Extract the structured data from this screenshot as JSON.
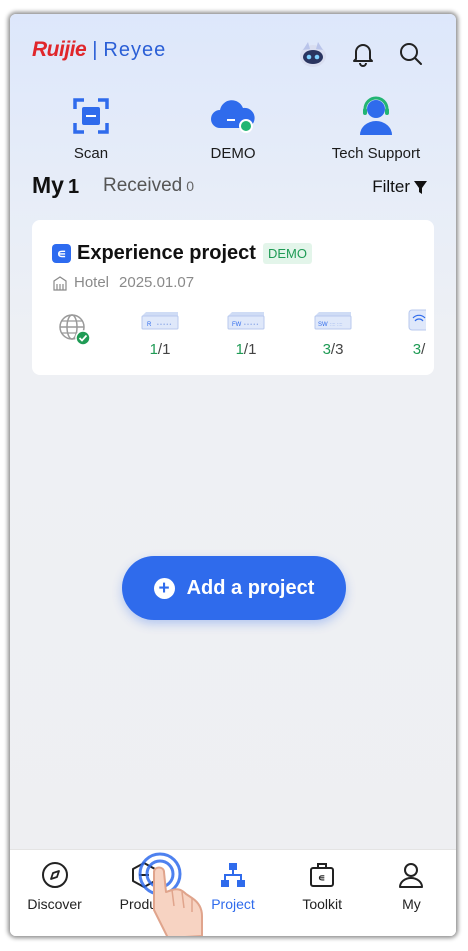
{
  "header": {
    "brand": "Ruijie",
    "separator": "|",
    "brand2": "Reyee",
    "icons": [
      "assistant-robot-icon",
      "bell-icon",
      "search-icon"
    ]
  },
  "quick_actions": [
    {
      "label": "Scan",
      "icon": "scan-icon"
    },
    {
      "label": "DEMO",
      "icon": "cloud-icon"
    },
    {
      "label": "Tech Support",
      "icon": "support-agent-icon"
    }
  ],
  "tabs": {
    "my_label": "My",
    "my_count": "1",
    "received_label": "Received",
    "received_count": "0",
    "filter_label": "Filter"
  },
  "project_card": {
    "name": "Experience project",
    "tag": "DEMO",
    "type": "Hotel",
    "date": "2025.01.07",
    "devices": [
      {
        "kind": "R",
        "online": "1",
        "total": "/1"
      },
      {
        "kind": "FW",
        "online": "1",
        "total": "/1"
      },
      {
        "kind": "SW",
        "online": "3",
        "total": "/3"
      },
      {
        "kind": "AP",
        "online": "3",
        "total": "/"
      }
    ]
  },
  "add_button": {
    "label": "Add a project"
  },
  "bottom_nav": [
    {
      "label": "Discover",
      "icon": "compass-icon"
    },
    {
      "label": "Product",
      "icon": "hexagon-icon"
    },
    {
      "label": "Project",
      "icon": "topology-icon",
      "active": true
    },
    {
      "label": "Toolkit",
      "icon": "toolbox-icon"
    },
    {
      "label": "My",
      "icon": "person-icon"
    }
  ],
  "colors": {
    "accent": "#2f6bec",
    "brand_red": "#e0262b",
    "success": "#1f9b55"
  }
}
